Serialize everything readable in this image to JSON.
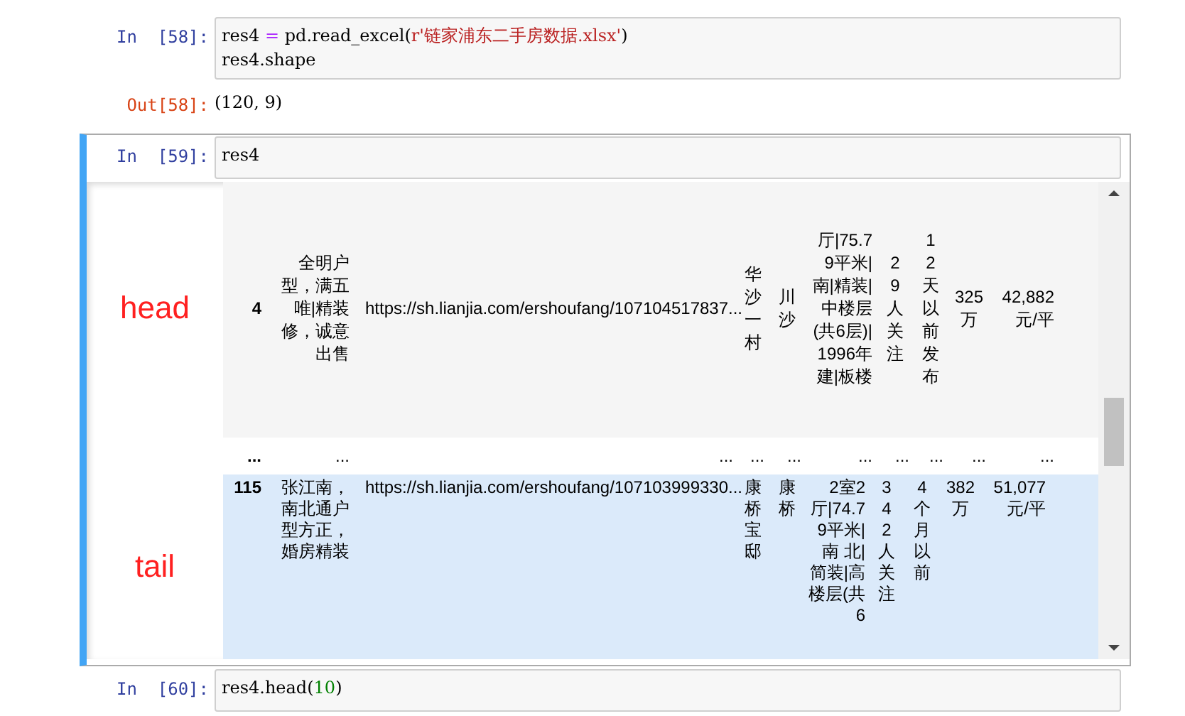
{
  "cells": [
    {
      "prompt": "In  [58]:",
      "selected": false,
      "lines": [
        [
          {
            "kind": "plain",
            "text": "res4 "
          },
          {
            "kind": "operator",
            "text": "="
          },
          {
            "kind": "plain",
            "text": " pd.read_excel("
          },
          {
            "kind": "string",
            "text": "r'链家浦东二手房数据.xlsx'"
          },
          {
            "kind": "plain",
            "text": ")"
          }
        ],
        [
          {
            "kind": "plain",
            "text": "res4.shape"
          }
        ]
      ],
      "output": {
        "kind": "text",
        "prompt": "Out[58]:",
        "text": "(120, 9)"
      }
    },
    {
      "prompt": "In  [59]:",
      "selected": true,
      "lines": [
        [
          {
            "kind": "plain",
            "text": "res4"
          }
        ]
      ],
      "output": {
        "kind": "table",
        "rows": [
          {
            "kind": "data",
            "label": "head",
            "highlighted": false,
            "cells": [
              "4",
              "全明户型，满五唯|精装修，诚意出售",
              "https://sh.lianjia.com/ershoufang/107104517837...",
              "华沙一村",
              "川沙",
              "厅|75.79平米|南|精装|中楼层(共6层)|1996年建|板楼",
              "29人关注",
              "12天以前发布",
              "325万",
              "42,882元/平"
            ]
          },
          {
            "kind": "ellipsis",
            "cells": [
              "...",
              "...",
              "...",
              "...",
              "...",
              "...",
              "...",
              "...",
              "...",
              "..."
            ]
          },
          {
            "kind": "data",
            "label": "tail",
            "highlighted": true,
            "cells": [
              "115",
              "张江南，南北通户型方正，婚房精装",
              "https://sh.lianjia.com/ershoufang/107103999330...",
              "康桥宝邸",
              "康桥",
              "2室2厅|74.79平米|南 北|简装|高楼层(共6",
              "342人关注",
              "4个月以前",
              "382万",
              "51,077元/平"
            ]
          }
        ]
      }
    },
    {
      "prompt": "In  [60]:",
      "selected": false,
      "lines": [
        [
          {
            "kind": "plain",
            "text": "res4.head("
          },
          {
            "kind": "number",
            "text": "10"
          },
          {
            "kind": "plain",
            "text": ")"
          }
        ]
      ]
    }
  ]
}
